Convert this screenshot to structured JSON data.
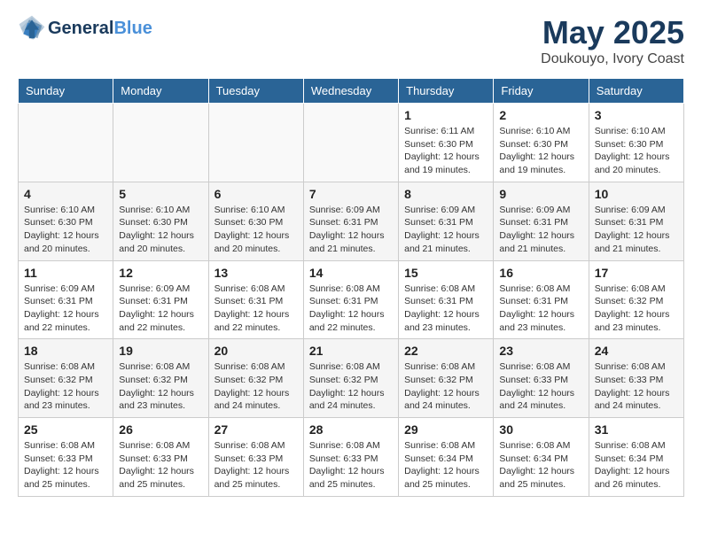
{
  "header": {
    "logo_line1": "General",
    "logo_line2": "Blue",
    "month": "May 2025",
    "location": "Doukouyo, Ivory Coast"
  },
  "weekdays": [
    "Sunday",
    "Monday",
    "Tuesday",
    "Wednesday",
    "Thursday",
    "Friday",
    "Saturday"
  ],
  "weeks": [
    [
      {
        "day": "",
        "info": ""
      },
      {
        "day": "",
        "info": ""
      },
      {
        "day": "",
        "info": ""
      },
      {
        "day": "",
        "info": ""
      },
      {
        "day": "1",
        "info": "Sunrise: 6:11 AM\nSunset: 6:30 PM\nDaylight: 12 hours\nand 19 minutes."
      },
      {
        "day": "2",
        "info": "Sunrise: 6:10 AM\nSunset: 6:30 PM\nDaylight: 12 hours\nand 19 minutes."
      },
      {
        "day": "3",
        "info": "Sunrise: 6:10 AM\nSunset: 6:30 PM\nDaylight: 12 hours\nand 20 minutes."
      }
    ],
    [
      {
        "day": "4",
        "info": "Sunrise: 6:10 AM\nSunset: 6:30 PM\nDaylight: 12 hours\nand 20 minutes."
      },
      {
        "day": "5",
        "info": "Sunrise: 6:10 AM\nSunset: 6:30 PM\nDaylight: 12 hours\nand 20 minutes."
      },
      {
        "day": "6",
        "info": "Sunrise: 6:10 AM\nSunset: 6:30 PM\nDaylight: 12 hours\nand 20 minutes."
      },
      {
        "day": "7",
        "info": "Sunrise: 6:09 AM\nSunset: 6:31 PM\nDaylight: 12 hours\nand 21 minutes."
      },
      {
        "day": "8",
        "info": "Sunrise: 6:09 AM\nSunset: 6:31 PM\nDaylight: 12 hours\nand 21 minutes."
      },
      {
        "day": "9",
        "info": "Sunrise: 6:09 AM\nSunset: 6:31 PM\nDaylight: 12 hours\nand 21 minutes."
      },
      {
        "day": "10",
        "info": "Sunrise: 6:09 AM\nSunset: 6:31 PM\nDaylight: 12 hours\nand 21 minutes."
      }
    ],
    [
      {
        "day": "11",
        "info": "Sunrise: 6:09 AM\nSunset: 6:31 PM\nDaylight: 12 hours\nand 22 minutes."
      },
      {
        "day": "12",
        "info": "Sunrise: 6:09 AM\nSunset: 6:31 PM\nDaylight: 12 hours\nand 22 minutes."
      },
      {
        "day": "13",
        "info": "Sunrise: 6:08 AM\nSunset: 6:31 PM\nDaylight: 12 hours\nand 22 minutes."
      },
      {
        "day": "14",
        "info": "Sunrise: 6:08 AM\nSunset: 6:31 PM\nDaylight: 12 hours\nand 22 minutes."
      },
      {
        "day": "15",
        "info": "Sunrise: 6:08 AM\nSunset: 6:31 PM\nDaylight: 12 hours\nand 23 minutes."
      },
      {
        "day": "16",
        "info": "Sunrise: 6:08 AM\nSunset: 6:31 PM\nDaylight: 12 hours\nand 23 minutes."
      },
      {
        "day": "17",
        "info": "Sunrise: 6:08 AM\nSunset: 6:32 PM\nDaylight: 12 hours\nand 23 minutes."
      }
    ],
    [
      {
        "day": "18",
        "info": "Sunrise: 6:08 AM\nSunset: 6:32 PM\nDaylight: 12 hours\nand 23 minutes."
      },
      {
        "day": "19",
        "info": "Sunrise: 6:08 AM\nSunset: 6:32 PM\nDaylight: 12 hours\nand 23 minutes."
      },
      {
        "day": "20",
        "info": "Sunrise: 6:08 AM\nSunset: 6:32 PM\nDaylight: 12 hours\nand 24 minutes."
      },
      {
        "day": "21",
        "info": "Sunrise: 6:08 AM\nSunset: 6:32 PM\nDaylight: 12 hours\nand 24 minutes."
      },
      {
        "day": "22",
        "info": "Sunrise: 6:08 AM\nSunset: 6:32 PM\nDaylight: 12 hours\nand 24 minutes."
      },
      {
        "day": "23",
        "info": "Sunrise: 6:08 AM\nSunset: 6:33 PM\nDaylight: 12 hours\nand 24 minutes."
      },
      {
        "day": "24",
        "info": "Sunrise: 6:08 AM\nSunset: 6:33 PM\nDaylight: 12 hours\nand 24 minutes."
      }
    ],
    [
      {
        "day": "25",
        "info": "Sunrise: 6:08 AM\nSunset: 6:33 PM\nDaylight: 12 hours\nand 25 minutes."
      },
      {
        "day": "26",
        "info": "Sunrise: 6:08 AM\nSunset: 6:33 PM\nDaylight: 12 hours\nand 25 minutes."
      },
      {
        "day": "27",
        "info": "Sunrise: 6:08 AM\nSunset: 6:33 PM\nDaylight: 12 hours\nand 25 minutes."
      },
      {
        "day": "28",
        "info": "Sunrise: 6:08 AM\nSunset: 6:33 PM\nDaylight: 12 hours\nand 25 minutes."
      },
      {
        "day": "29",
        "info": "Sunrise: 6:08 AM\nSunset: 6:34 PM\nDaylight: 12 hours\nand 25 minutes."
      },
      {
        "day": "30",
        "info": "Sunrise: 6:08 AM\nSunset: 6:34 PM\nDaylight: 12 hours\nand 25 minutes."
      },
      {
        "day": "31",
        "info": "Sunrise: 6:08 AM\nSunset: 6:34 PM\nDaylight: 12 hours\nand 26 minutes."
      }
    ]
  ]
}
